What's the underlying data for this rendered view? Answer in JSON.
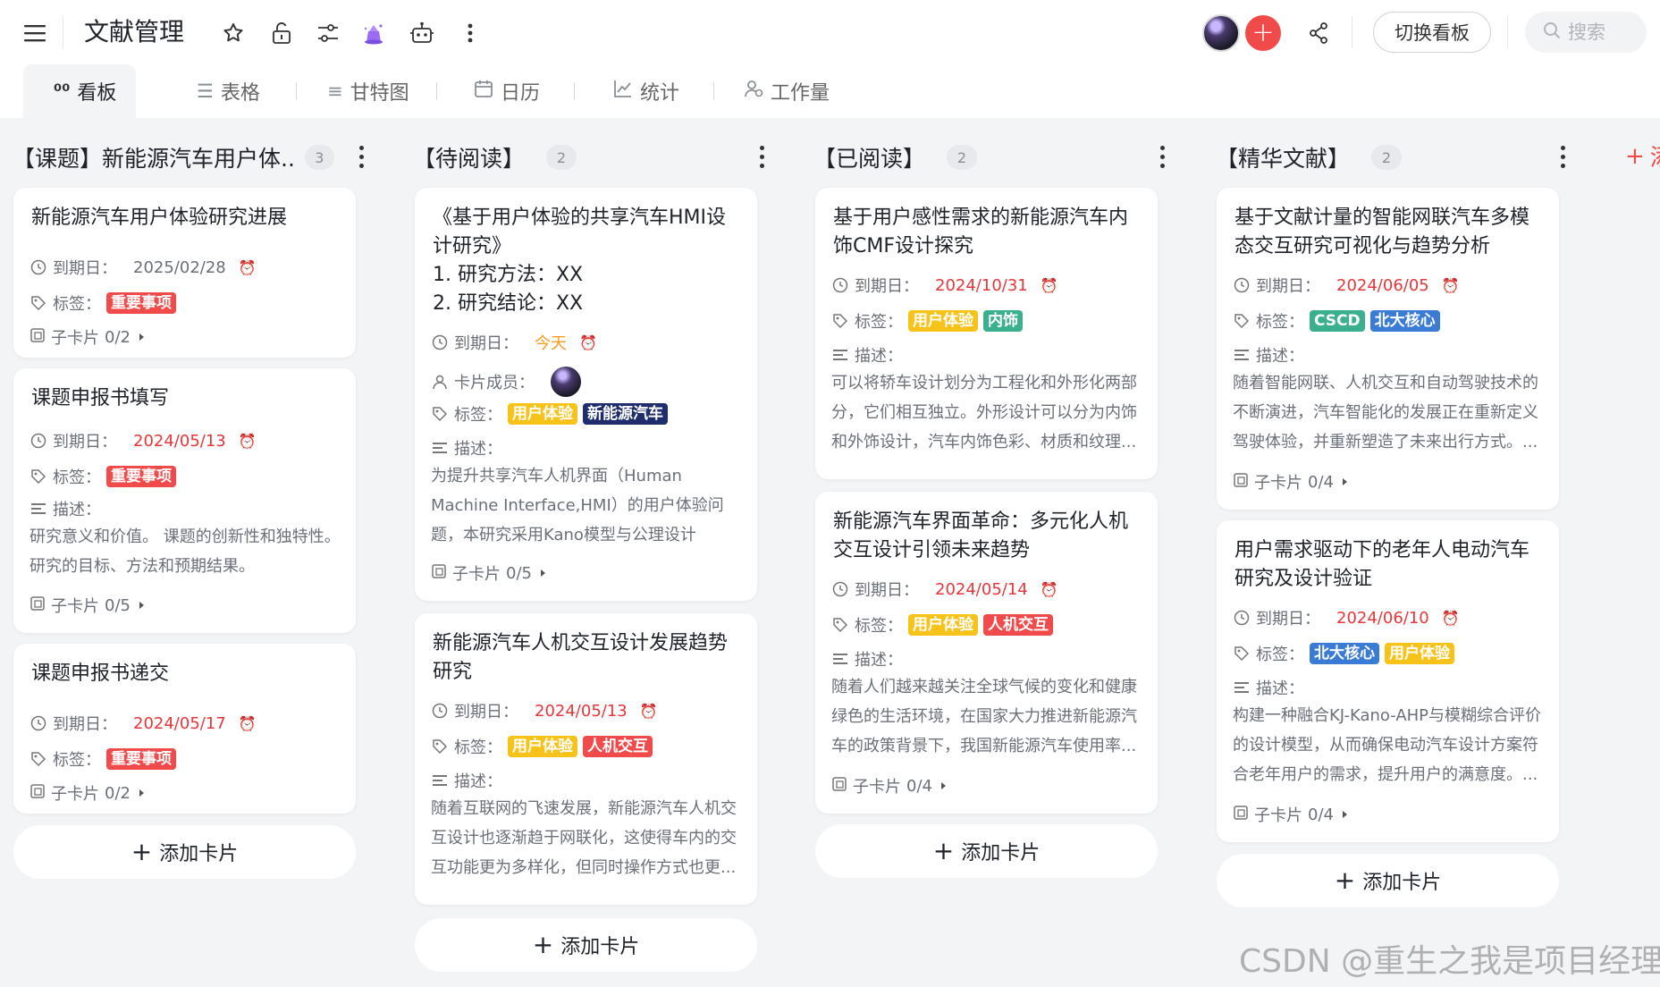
{
  "app": {
    "title": "文献管理",
    "switch_board_label": "切换看板",
    "search_placeholder": "搜索",
    "top_icons": [
      "menu-icon",
      "star-icon",
      "lock-icon",
      "sliders-icon",
      "magic-hat-icon",
      "robot-icon",
      "more-vertical-icon",
      "share-icon",
      "search-icon"
    ]
  },
  "tabs": [
    {
      "label": "看板",
      "icon": "kanban-icon",
      "active": true
    },
    {
      "label": "表格",
      "icon": "list-icon"
    },
    {
      "label": "甘特图",
      "icon": "gantt-icon"
    },
    {
      "label": "日历",
      "icon": "calendar-icon"
    },
    {
      "label": "统计",
      "icon": "chart-icon"
    },
    {
      "label": "工作量",
      "icon": "workload-icon"
    }
  ],
  "labels": {
    "due": "到期日：",
    "tags": "标签：",
    "desc": "描述：",
    "members": "卡片成员：",
    "subcard_prefix": "子卡片",
    "add_card": "添加卡片",
    "add_column": "添"
  },
  "colors": {
    "accent": "#f04a4a",
    "tag_important": "#f04a4a",
    "tag_ux": "#f7c31a",
    "tag_nev": "#1f2d6e",
    "tag_interior": "#3bb08f",
    "tag_hci": "#f04a4a",
    "tag_cscd": "#3bb08f",
    "tag_pku": "#3a7bd5"
  },
  "columns": [
    {
      "name": "【课题】新能源汽车用户体...",
      "count": "3",
      "cards": [
        {
          "title": "新能源汽车用户体验研究进展",
          "due": "2025/02/28",
          "tags": [
            "重要事项"
          ],
          "sub": "0/2"
        },
        {
          "title": "课题申报书填写",
          "due": "2024/05/13",
          "tags": [
            "重要事项"
          ],
          "desc": "研究意义和价值。 课题的创新性和独特性。研究的目标、方法和预期结果。",
          "sub": "0/5"
        },
        {
          "title": "课题申报书递交",
          "due": "2024/05/17",
          "tags": [
            "重要事项"
          ],
          "sub": "0/2"
        }
      ]
    },
    {
      "name": "【待阅读】",
      "count": "2",
      "cards": [
        {
          "title": "《基于用户体验的共享汽车HMI设计研究》",
          "lines": [
            "1. 研究方法：XX",
            "2. 研究结论：XX"
          ],
          "due": "今天",
          "tags": [
            "用户体验",
            "新能源汽车"
          ],
          "desc": "为提升共享汽车人机界面（Human Machine Interface,HMI）的用户体验问题，本研究采用Kano模型与公理设计（Axiomatic...",
          "sub": "0/5"
        },
        {
          "title": "新能源汽车人机交互设计发展趋势研究",
          "due": "2024/05/13",
          "tags": [
            "用户体验",
            "人机交互"
          ],
          "desc": "随着互联网的飞速发展，新能源汽车人机交互设计也逐渐趋于网联化，这使得车内的交互功能更为多样化，但同时操作方式也更..."
        }
      ]
    },
    {
      "name": "【已阅读】",
      "count": "2",
      "cards": [
        {
          "title": "基于用户感性需求的新能源汽车内饰CMF设计探究",
          "due": "2024/10/31",
          "tags": [
            "用户体验",
            "内饰"
          ],
          "desc": "可以将轿车设计划分为工程化和外形化两部分，它们相互独立。外形设计可以分为内饰和外饰设计，汽车内饰色彩、材质和纹理..."
        },
        {
          "title": "新能源汽车界面革命：多元化人机交互设计引领未来趋势",
          "due": "2024/05/14",
          "tags": [
            "用户体验",
            "人机交互"
          ],
          "desc": "随着人们越来越关注全球气候的变化和健康绿色的生活环境，在国家大力推进新能源汽车的政策背景下，我国新能源汽车使用率...",
          "sub": "0/4"
        }
      ]
    },
    {
      "name": "【精华文献】",
      "count": "2",
      "cards": [
        {
          "title": "基于文献计量的智能网联汽车多模态交互研究可视化与趋势分析",
          "due": "2024/06/05",
          "tags": [
            "CSCD",
            "北大核心"
          ],
          "desc": "随着智能网联、人机交互和自动驾驶技术的不断演进，汽车智能化的发展正在重新定义驾驶体验，并重新塑造了未来出行方式。...",
          "sub": "0/4"
        },
        {
          "title": "用户需求驱动下的老年人电动汽车研究及设计验证",
          "due": "2024/06/10",
          "tags": [
            "北大核心",
            "用户体验"
          ],
          "desc": "构建一种融合KJ-Kano-AHP与模糊综合评价的设计模型，从而确保电动汽车设计方案符合老年用户的需求，提升用户的满意度。...",
          "sub": "0/4"
        }
      ]
    }
  ],
  "watermark": "CSDN @重生之我是项目经理"
}
